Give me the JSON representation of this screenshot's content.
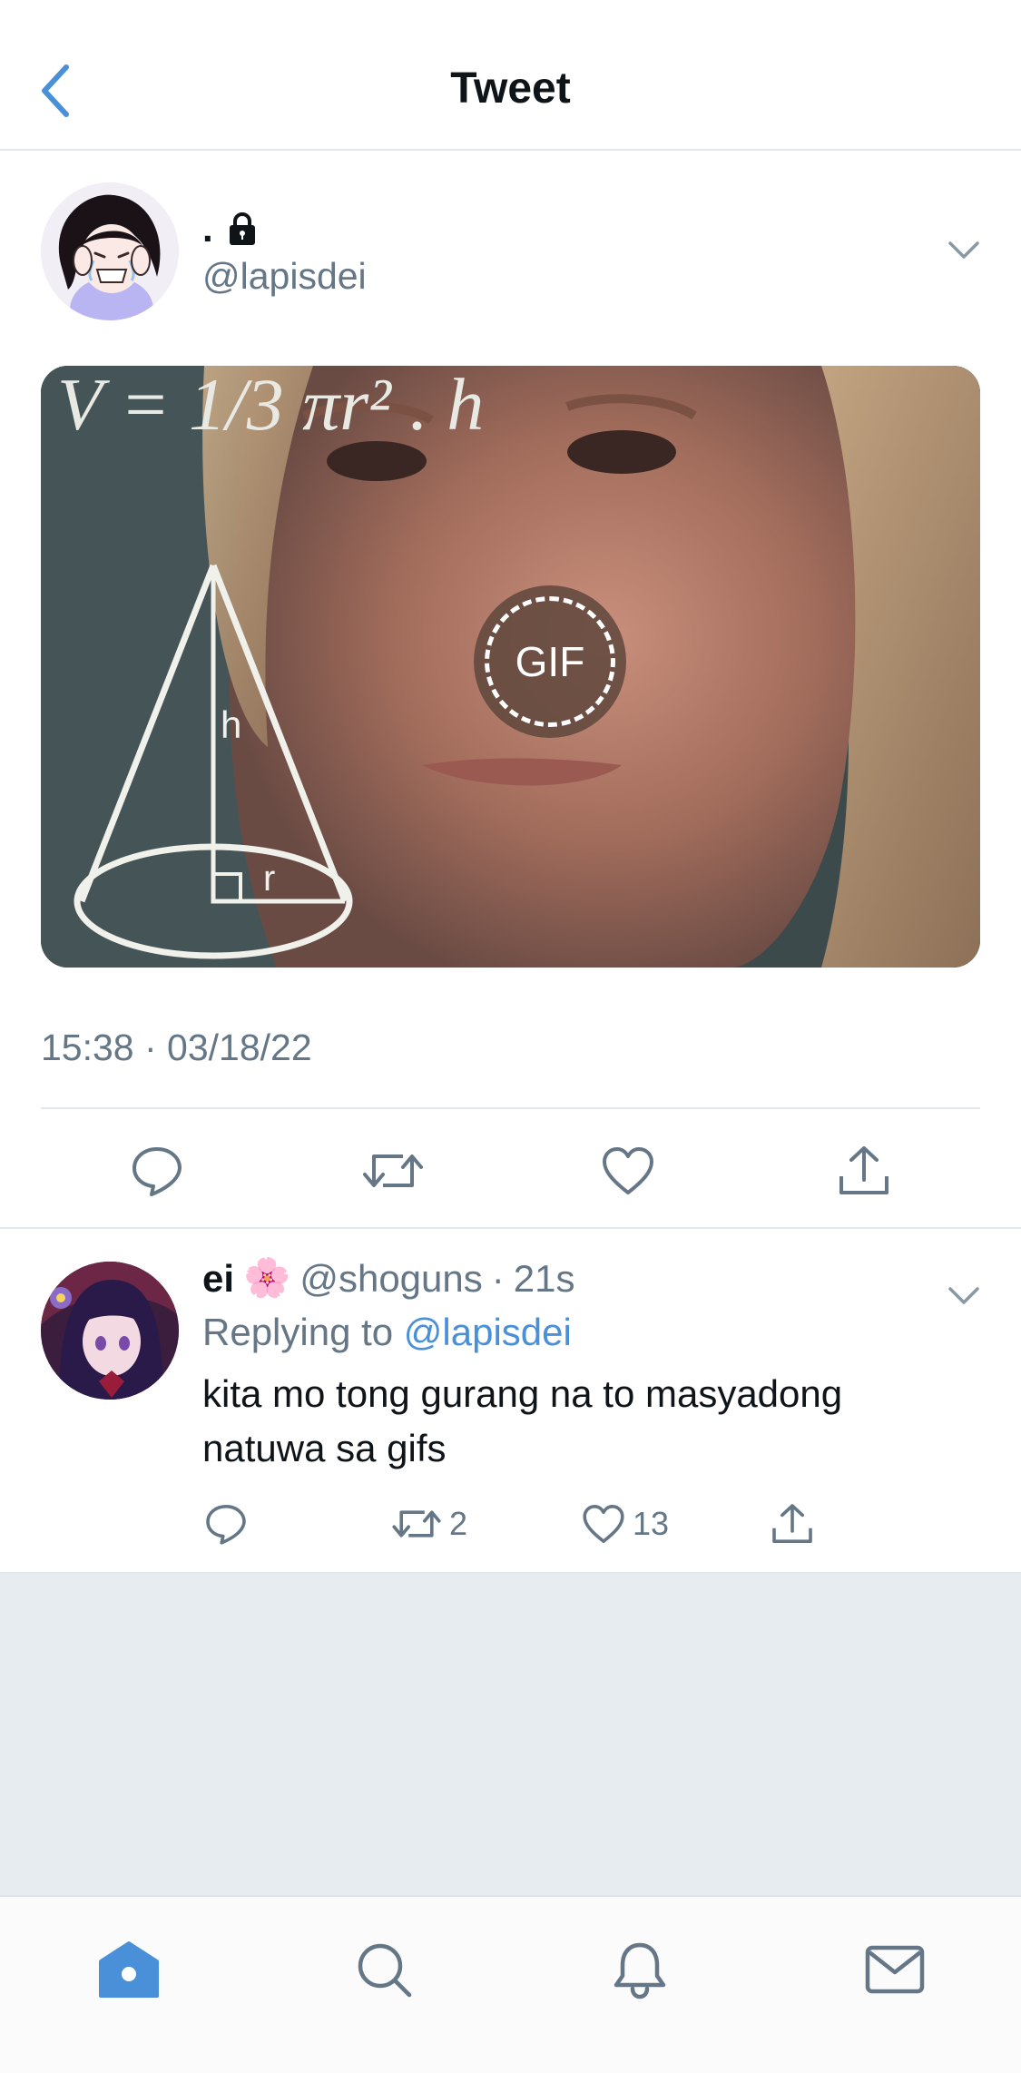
{
  "header": {
    "title": "Tweet",
    "back_icon": "chevron-left-icon"
  },
  "main_tweet": {
    "display_name": ".",
    "protected_icon": "lock-icon",
    "handle": "@lapisdei",
    "media": {
      "badge_label": "GIF",
      "overlay_text": "V = 1/3 πr² . h",
      "overlay_h": "h",
      "overlay_r": "r"
    },
    "timestamp": "15:38 · 03/18/22",
    "actions": [
      "reply-icon",
      "retweet-icon",
      "like-icon",
      "share-icon"
    ]
  },
  "reply": {
    "name": "ei",
    "emoji": "🌸",
    "handle": "@shoguns",
    "dot": "·",
    "time": "21s",
    "replying_prefix": "Replying to",
    "replying_handle": "@lapisdei",
    "text": "kita mo tong gurang na to masyadong natuwa sa gifs",
    "retweet_count": "2",
    "like_count": "13"
  },
  "tabbar": {
    "items": [
      "home-icon",
      "search-icon",
      "notifications-icon",
      "messages-icon"
    ],
    "active": "home-icon"
  },
  "colors": {
    "accent": "#4a90d9",
    "secondary_text": "#657786",
    "divider": "#e1e8ed",
    "filler": "#e6ecf0"
  }
}
